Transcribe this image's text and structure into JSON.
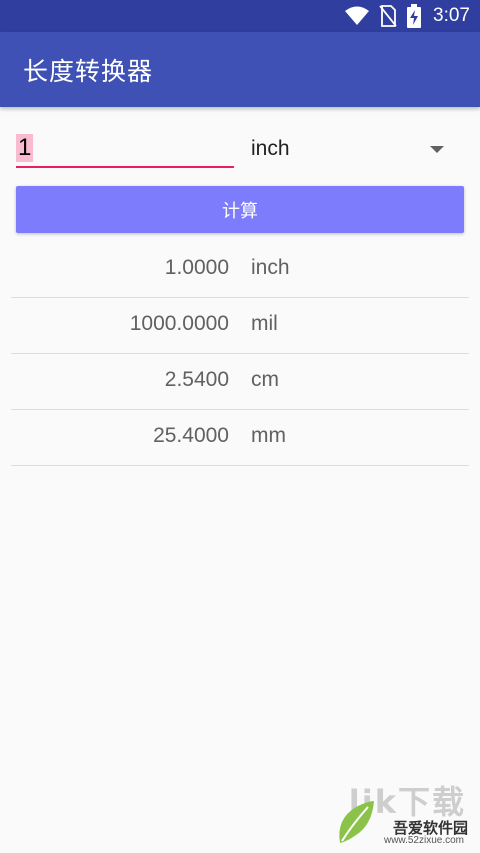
{
  "status_bar": {
    "time": "3:07",
    "icons": [
      "wifi-icon",
      "no-sim-icon",
      "battery-charging-icon"
    ]
  },
  "app_bar": {
    "title": "长度转换器"
  },
  "input": {
    "value": "1"
  },
  "unit_select": {
    "selected": "inch"
  },
  "calc_button": {
    "label": "计算"
  },
  "results": [
    {
      "value": "1.0000",
      "unit": "inch"
    },
    {
      "value": "1000.0000",
      "unit": "mil"
    },
    {
      "value": "2.5400",
      "unit": "cm"
    },
    {
      "value": "25.4000",
      "unit": "mm"
    }
  ],
  "watermark": {
    "letters": "lik下载",
    "name": "吾爱软件园",
    "url": "www.52zixue.com"
  },
  "colors": {
    "status_bar": "#303f9f",
    "app_bar": "#3f51b5",
    "accent": "#e91e63",
    "button": "#7c7cfc"
  }
}
